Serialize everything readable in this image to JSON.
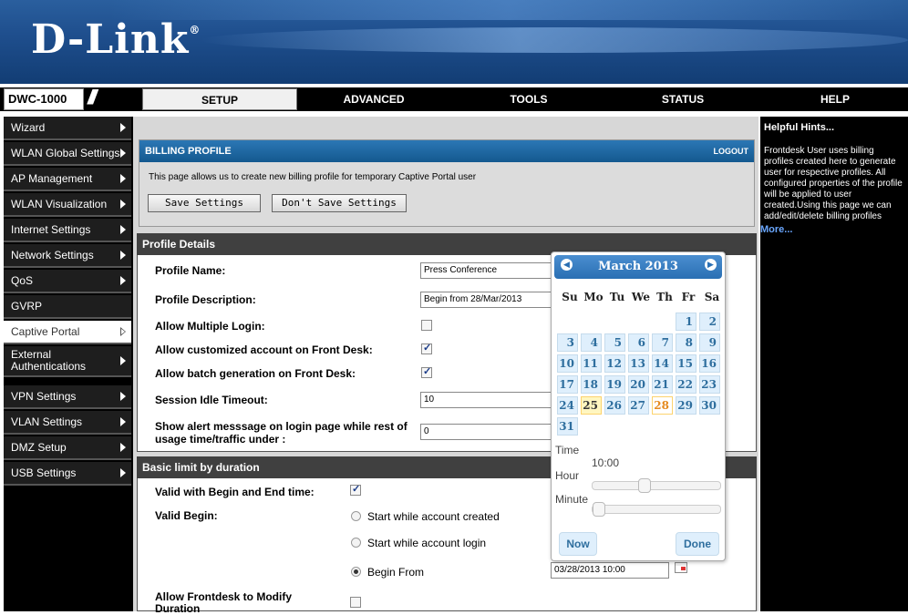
{
  "header": {
    "logo": "D-Link",
    "model": "DWC-1000"
  },
  "tabs": [
    "SETUP",
    "ADVANCED",
    "TOOLS",
    "STATUS",
    "HELP"
  ],
  "sidebar": {
    "items": [
      {
        "label": "Wizard"
      },
      {
        "label": "WLAN Global Settings"
      },
      {
        "label": "AP Management"
      },
      {
        "label": "WLAN Visualization"
      },
      {
        "label": "Internet Settings"
      },
      {
        "label": "Network Settings"
      },
      {
        "label": "QoS"
      },
      {
        "label": "GVRP"
      },
      {
        "label": "Captive Portal"
      },
      {
        "label": "External Authentications"
      },
      {
        "label": "VPN Settings"
      },
      {
        "label": "VLAN Settings"
      },
      {
        "label": "DMZ Setup"
      },
      {
        "label": "USB Settings"
      }
    ]
  },
  "billing": {
    "title": "BILLING PROFILE",
    "logout": "LOGOUT",
    "description": "This page allows us to create new billing profile for temporary Captive Portal user",
    "save": "Save Settings",
    "dont_save": "Don't Save Settings"
  },
  "profile": {
    "section": "Profile Details",
    "name_label": "Profile Name:",
    "name_value": "Press Conference",
    "desc_label": "Profile Description:",
    "desc_value": "Begin from 28/Mar/2013",
    "multi_label": "Allow Multiple Login:",
    "custom_label": "Allow customized account on Front Desk:",
    "batch_label": "Allow batch generation on Front Desk:",
    "idle_label": "Session Idle Timeout:",
    "idle_value": "10",
    "alert_label": "Show alert messsage on login page while rest of usage time/traffic under :",
    "alert_value": "0"
  },
  "basic": {
    "section": "Basic limit by duration",
    "valid_label": "Valid with Begin and End time:",
    "begin_label": "Valid Begin:",
    "opt1": "Start while account created",
    "opt2": "Start while account login",
    "opt3": "Begin From",
    "begin_value": "03/28/2013 10:00",
    "modify_label": "Allow Frontdesk to Modify Duration"
  },
  "help": {
    "title": "Helpful Hints...",
    "text": "Frontdesk User uses billing profiles created here to generate user for respective profiles. All configured properties of the profile will be applied to user created.Using this page we can add/edit/delete billing profiles",
    "more": "More..."
  },
  "calendar": {
    "month": "March 2013",
    "dow": [
      "Su",
      "Mo",
      "Tu",
      "We",
      "Th",
      "Fr",
      "Sa"
    ],
    "days": [
      "1",
      "2",
      "3",
      "4",
      "5",
      "6",
      "7",
      "8",
      "9",
      "10",
      "11",
      "12",
      "13",
      "14",
      "15",
      "16",
      "17",
      "18",
      "19",
      "20",
      "21",
      "22",
      "23",
      "24",
      "25",
      "26",
      "27",
      "28",
      "29",
      "30",
      "31"
    ],
    "time_label": "Time",
    "time_value": "10:00",
    "hour_label": "Hour",
    "minute_label": "Minute",
    "hour_level": 0.4,
    "minute_level": 0.0,
    "now": "Now",
    "done": "Done"
  }
}
